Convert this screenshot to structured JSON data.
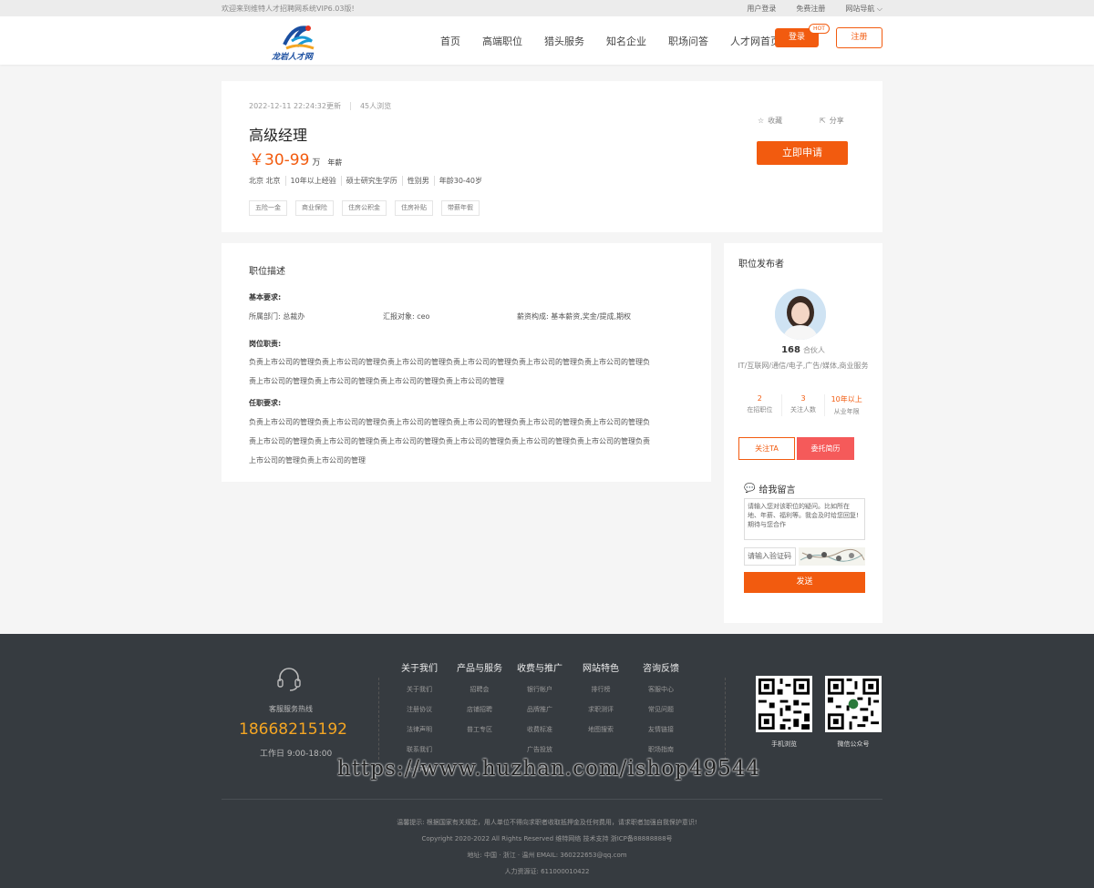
{
  "topbar": {
    "welcome": "欢迎来到维特人才招聘网系统VIP6.03版!",
    "user_login": "用户登录",
    "free_register": "免费注册",
    "site_nav": "网站导航"
  },
  "header": {
    "logo_text": "龙岩人才网",
    "nav": [
      "首页",
      "高端职位",
      "猎头服务",
      "知名企业",
      "职场问答",
      "人才网首页"
    ],
    "login": "登录",
    "hot": "HOT",
    "register": "注册"
  },
  "job": {
    "updated": "2022-12-11 22:24:32更新",
    "views": "45人浏览",
    "title": "高级经理",
    "salary": "￥30-99",
    "salary_unit": "万",
    "salary_period": "年薪",
    "requirements": [
      "北京 北京",
      "10年以上经验",
      "硕士研究生学历",
      "性别男",
      "年龄30-40岁"
    ],
    "tags": [
      "五险一金",
      "商业保险",
      "住房公积金",
      "住房补贴",
      "带薪年假"
    ],
    "collect": "收藏",
    "share": "分享",
    "apply": "立即申请"
  },
  "description": {
    "heading": "职位描述",
    "basic_label": "基本要求:",
    "department": "所属部门: 总裁办",
    "report_to": "汇报对象: ceo",
    "salary_structure": "薪资构成: 基本薪资,奖金/提成,期权",
    "duty_label": "岗位职责:",
    "duty_text": "负责上市公司的管理负责上市公司的管理负责上市公司的管理负责上市公司的管理负责上市公司的管理负责上市公司的管理负责上市公司的管理负责上市公司的管理负责上市公司的管理负责上市公司的管理",
    "qual_label": "任职要求:",
    "qual_text": "负责上市公司的管理负责上市公司的管理负责上市公司的管理负责上市公司的管理负责上市公司的管理负责上市公司的管理负责上市公司的管理负责上市公司的管理负责上市公司的管理负责上市公司的管理负责上市公司的管理负责上市公司的管理负责上市公司的管理负责上市公司的管理"
  },
  "publisher": {
    "heading": "职位发布者",
    "name": "168",
    "title": "合伙人",
    "industry": "IT/互联网/通信/电子,广告/媒体,商业服务",
    "stats": [
      {
        "num": "2",
        "label": "在招职位"
      },
      {
        "num": "3",
        "label": "关注人数"
      },
      {
        "num": "10年以上",
        "label": "从业年限"
      }
    ],
    "follow": "关注TA",
    "entrust": "委托简历",
    "message_title": "给我留言",
    "message_placeholder": "请输入您对该职位的疑问。比如所在地、年薪、福利等。我会及时给您回复!期待与您合作",
    "captcha_placeholder": "请输入验证码",
    "send": "发送"
  },
  "footer": {
    "hotline_label": "客服服务热线",
    "hotline": "18668215192",
    "hours": "工作日 9:00-18:00",
    "columns": [
      {
        "title": "关于我们",
        "items": [
          "关于我们",
          "注册协议",
          "法律声明",
          "联系我们",
          "免责声明"
        ]
      },
      {
        "title": "产品与服务",
        "items": [
          "招聘会",
          "店铺招聘",
          "普工专区"
        ]
      },
      {
        "title": "收费与推广",
        "items": [
          "银行帐户",
          "品牌推广",
          "收费标准",
          "广告投放"
        ]
      },
      {
        "title": "网站特色",
        "items": [
          "排行榜",
          "求职测评",
          "地图搜索"
        ]
      },
      {
        "title": "咨询反馈",
        "items": [
          "客服中心",
          "常见问题",
          "友情链接",
          "职场指南"
        ]
      }
    ],
    "qr_mobile": "手机浏览",
    "qr_wechat": "微信公众号",
    "notice": "温馨提示: 根据国家有关规定，用人单位不得向求职者收取抵押金及任何费用，请求职者加强自我保护意识!",
    "copyright": "Copyright 2020-2022 All Rights Reserved 维特网络 技术支持 浙ICP备88888888号",
    "address": "地址: 中国 · 浙江 · 温州 EMAIL: 360222653@qq.com",
    "hr_license": "人力资源证: 611000010422"
  },
  "watermark": "https://www.huzhan.com/ishop49544",
  "colors": {
    "accent": "#f25b0f",
    "footer_bg": "#363b40",
    "hotline": "#f5a623"
  }
}
